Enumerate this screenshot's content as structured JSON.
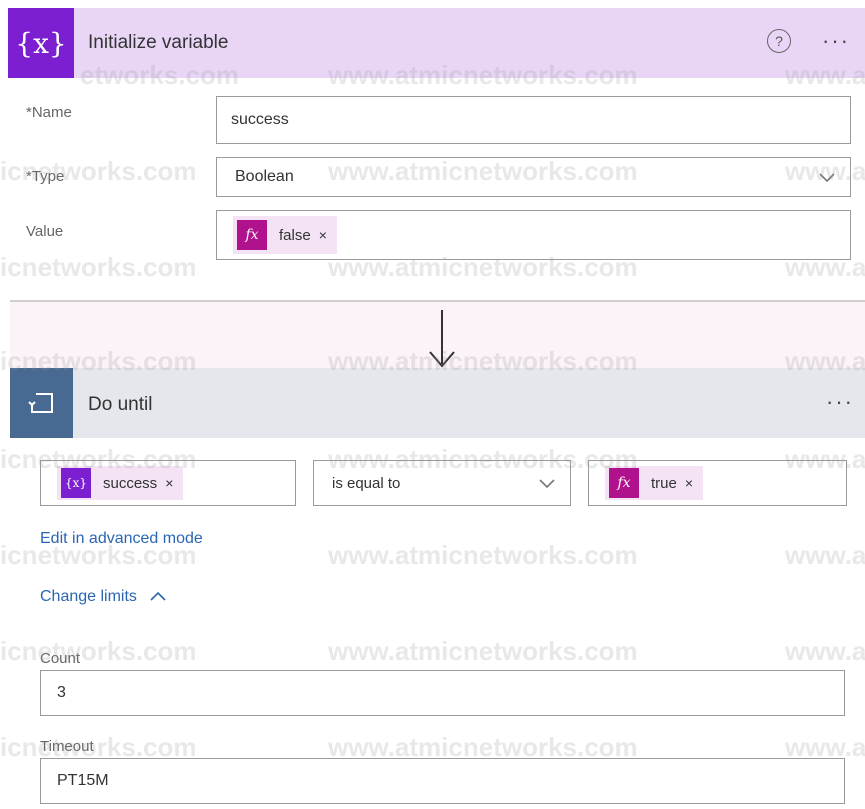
{
  "init_variable": {
    "title": "Initialize variable",
    "icon_text": "{x}",
    "help_glyph": "?",
    "more_glyph": "···",
    "name_label": "*Name",
    "name_value": "success",
    "type_label": "*Type",
    "type_value": "Boolean",
    "value_label": "Value",
    "value_chip": {
      "icon_text": "fx",
      "label": "false",
      "remove": "×"
    }
  },
  "do_until": {
    "title": "Do until",
    "more_glyph": "···",
    "condition": {
      "left_chip": {
        "icon_text": "{x}",
        "label": "success",
        "remove": "×"
      },
      "operator": "is equal to",
      "right_chip": {
        "icon_text": "fx",
        "label": "true",
        "remove": "×"
      }
    },
    "edit_advanced_link": "Edit in advanced mode",
    "change_limits_link": "Change limits",
    "count_label": "Count",
    "count_value": "3",
    "timeout_label": "Timeout",
    "timeout_value": "PT15M"
  },
  "watermark": {
    "full": "www.atmicnetworks.com",
    "left_1": "etworks.com",
    "left_2": "icnetworks.com",
    "right": "www.a"
  },
  "colors": {
    "init_header_bg": "#e9d6f7",
    "init_icon_bg": "#7b1fd0",
    "expression_icon_bg": "#b0128e",
    "do_until_header_bg": "#e4e7ec",
    "do_until_icon_bg": "#486991",
    "link": "#2a66b3"
  },
  "icons": {
    "variable": "variable-braces-icon",
    "help": "help-circle-icon",
    "expression": "fx-expression-icon",
    "dropdown": "chevron-down-icon",
    "loop": "do-until-loop-icon",
    "arrow": "arrow-down-icon",
    "collapse": "chevron-up-icon",
    "remove": "close-icon"
  }
}
